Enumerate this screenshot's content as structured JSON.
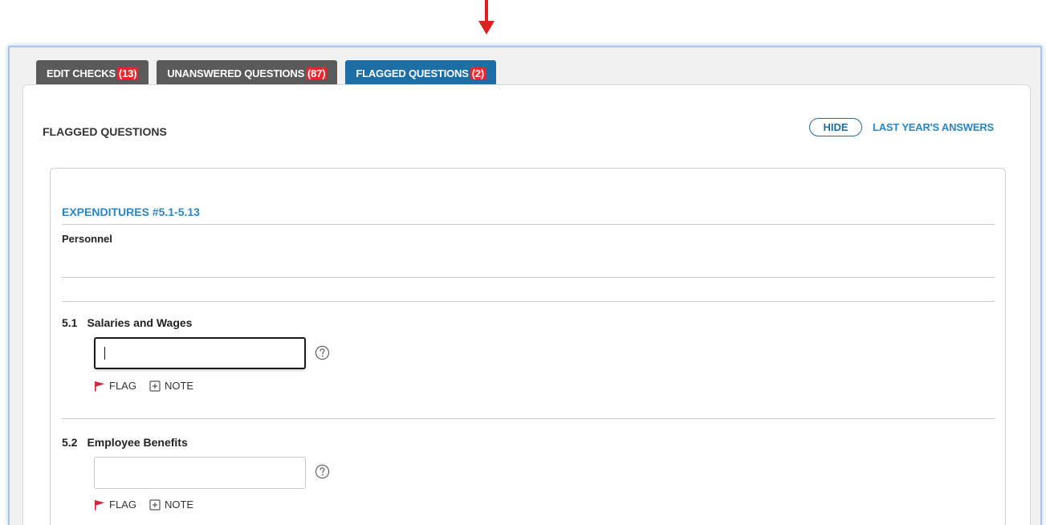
{
  "tabs": [
    {
      "label": "EDIT CHECKS ",
      "count": "(13)",
      "active": false
    },
    {
      "label": "UNANSWERED QUESTIONS ",
      "count": "(87)",
      "active": false
    },
    {
      "label": "FLAGGED QUESTIONS ",
      "count": "(2)",
      "active": true
    }
  ],
  "panel": {
    "title": "FLAGGED QUESTIONS",
    "hide_label": "HIDE",
    "last_year_label": "LAST YEAR'S ANSWERS"
  },
  "section": {
    "title": "EXPENDITURES #5.1-5.13",
    "subtitle": "Personnel"
  },
  "questions": [
    {
      "number": "5.1",
      "label": "Salaries and Wages",
      "value": "",
      "flag_label": "FLAG",
      "note_label": "NOTE"
    },
    {
      "number": "5.2",
      "label": "Employee Benefits",
      "value": "",
      "flag_label": "FLAG",
      "note_label": "NOTE"
    }
  ],
  "colors": {
    "accent": "#1e6ea6",
    "badge": "#e8262b",
    "flag": "#d0213a",
    "arrow": "#e02020"
  }
}
